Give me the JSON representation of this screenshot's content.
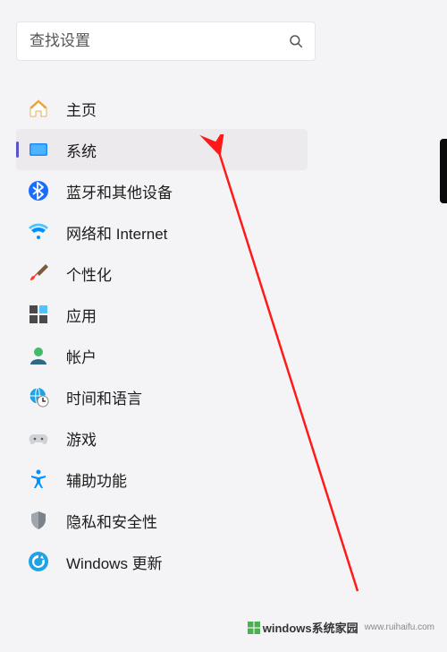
{
  "search": {
    "placeholder": "查找设置"
  },
  "nav": {
    "items": [
      {
        "key": "home",
        "label": "主页"
      },
      {
        "key": "system",
        "label": "系统"
      },
      {
        "key": "bluetooth",
        "label": "蓝牙和其他设备"
      },
      {
        "key": "network",
        "label": "网络和 Internet"
      },
      {
        "key": "personalize",
        "label": "个性化"
      },
      {
        "key": "apps",
        "label": "应用"
      },
      {
        "key": "accounts",
        "label": "帐户"
      },
      {
        "key": "time",
        "label": "时间和语言"
      },
      {
        "key": "gaming",
        "label": "游戏"
      },
      {
        "key": "accessibility",
        "label": "辅助功能"
      },
      {
        "key": "privacy",
        "label": "隐私和安全性"
      },
      {
        "key": "update",
        "label": "Windows 更新"
      }
    ],
    "selected_key": "system"
  },
  "watermark": {
    "brand": "windows系统家园",
    "domain": "www.ruihaifu.com"
  }
}
